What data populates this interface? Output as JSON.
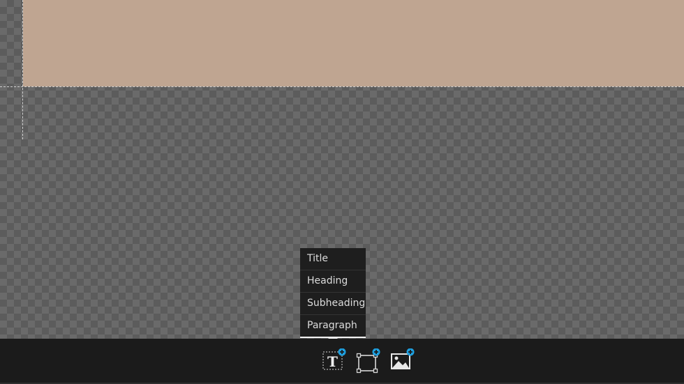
{
  "canvas": {
    "artboard_color": "#bfa591",
    "background": "checkerboard-transparent"
  },
  "text_menu": {
    "items": [
      {
        "label": "Title"
      },
      {
        "label": "Heading"
      },
      {
        "label": "Subheading"
      },
      {
        "label": "Paragraph"
      }
    ]
  },
  "toolbar": {
    "tools": [
      {
        "icon": "add-text-icon",
        "active": true
      },
      {
        "icon": "add-shape-icon",
        "active": false
      },
      {
        "icon": "add-image-icon",
        "active": false
      }
    ],
    "accent_color": "#1ea0e0"
  }
}
